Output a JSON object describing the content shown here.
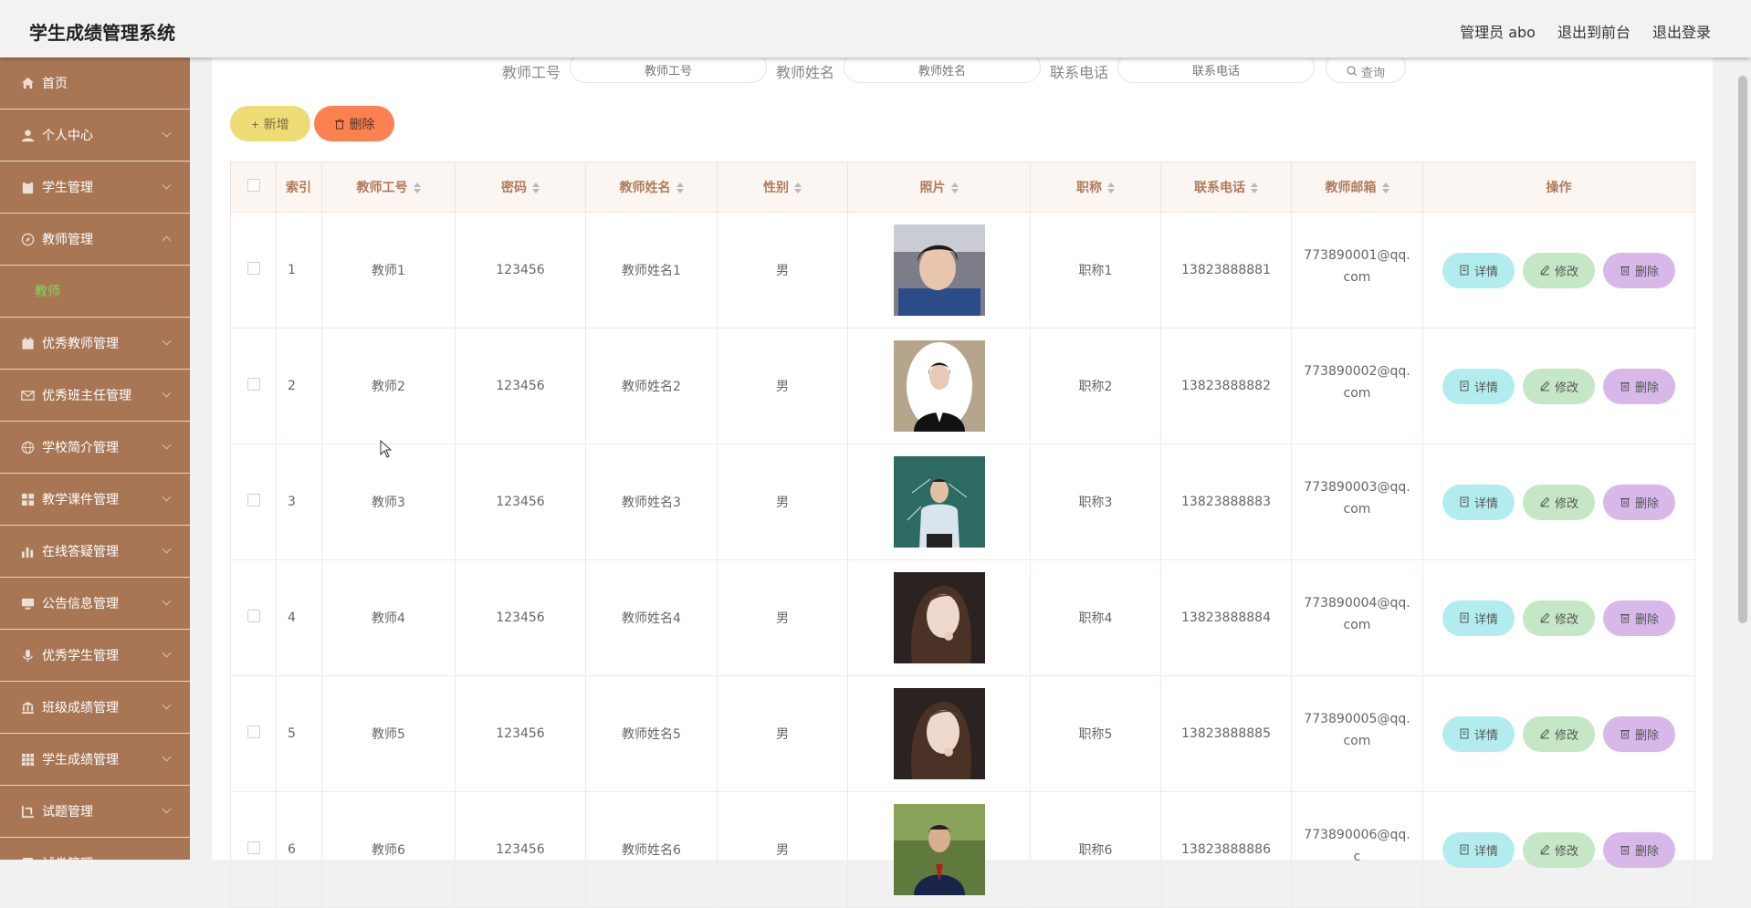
{
  "header": {
    "title": "学生成绩管理系统",
    "links": [
      "管理员 abo",
      "退出到前台",
      "退出登录"
    ]
  },
  "sidebar": {
    "items": [
      {
        "label": "首页",
        "icon": "home-icon",
        "chevron": false
      },
      {
        "label": "个人中心",
        "icon": "user-icon",
        "chevron": true
      },
      {
        "label": "学生管理",
        "icon": "clipboard-icon",
        "chevron": true
      },
      {
        "label": "教师管理",
        "icon": "compass-icon",
        "chevron": true,
        "expanded": true,
        "children": [
          "教师"
        ]
      },
      {
        "label": "优秀教师管理",
        "icon": "calendar-icon",
        "chevron": true
      },
      {
        "label": "优秀班主任管理",
        "icon": "mail-icon",
        "chevron": true
      },
      {
        "label": "学校简介管理",
        "icon": "globe-icon",
        "chevron": true
      },
      {
        "label": "教学课件管理",
        "icon": "grid-icon",
        "chevron": true
      },
      {
        "label": "在线答疑管理",
        "icon": "bar-chart-icon",
        "chevron": true
      },
      {
        "label": "公告信息管理",
        "icon": "monitor-icon",
        "chevron": true
      },
      {
        "label": "优秀学生管理",
        "icon": "microphone-icon",
        "chevron": true
      },
      {
        "label": "班级成绩管理",
        "icon": "bank-icon",
        "chevron": true
      },
      {
        "label": "学生成绩管理",
        "icon": "table-icon",
        "chevron": true
      },
      {
        "label": "试题管理",
        "icon": "crop-icon",
        "chevron": true
      },
      {
        "label": "试卷管理",
        "icon": "doc-icon",
        "chevron": true
      }
    ]
  },
  "search": {
    "fields": [
      {
        "label": "教师工号",
        "placeholder": "教师工号"
      },
      {
        "label": "教师姓名",
        "placeholder": "教师姓名"
      },
      {
        "label": "联系电话",
        "placeholder": "联系电话"
      }
    ],
    "query_label": "查询"
  },
  "actions": {
    "add_label": "新增",
    "delete_label": "删除"
  },
  "table": {
    "columns": [
      "索引",
      "教师工号",
      "密码",
      "教师姓名",
      "性别",
      "照片",
      "职称",
      "联系电话",
      "教师邮箱",
      "操作"
    ],
    "op_labels": {
      "detail": "详情",
      "edit": "修改",
      "remove": "删除"
    },
    "rows": [
      {
        "index": "1",
        "id": "教师1",
        "password": "123456",
        "name": "教师姓名1",
        "gender": "男",
        "title": "职称1",
        "phone": "13823888881",
        "email": "773890001@qq.com"
      },
      {
        "index": "2",
        "id": "教师2",
        "password": "123456",
        "name": "教师姓名2",
        "gender": "男",
        "title": "职称2",
        "phone": "13823888882",
        "email": "773890002@qq.com"
      },
      {
        "index": "3",
        "id": "教师3",
        "password": "123456",
        "name": "教师姓名3",
        "gender": "男",
        "title": "职称3",
        "phone": "13823888883",
        "email": "773890003@qq.com"
      },
      {
        "index": "4",
        "id": "教师4",
        "password": "123456",
        "name": "教师姓名4",
        "gender": "男",
        "title": "职称4",
        "phone": "13823888884",
        "email": "773890004@qq.com"
      },
      {
        "index": "5",
        "id": "教师5",
        "password": "123456",
        "name": "教师姓名5",
        "gender": "男",
        "title": "职称5",
        "phone": "13823888885",
        "email": "773890005@qq.com"
      },
      {
        "index": "6",
        "id": "教师6",
        "password": "123456",
        "name": "教师姓名6",
        "gender": "男",
        "title": "职称6",
        "phone": "13823888886",
        "email": "773890006@qq.c"
      }
    ]
  },
  "colors": {
    "sidebar": "#a87654",
    "active_sub": "#7cdc5e",
    "add": "#eedd76",
    "delete": "#fb8150",
    "detail": "#b3ecef",
    "edit": "#c5e7c5",
    "remove": "#d7b8e8"
  }
}
